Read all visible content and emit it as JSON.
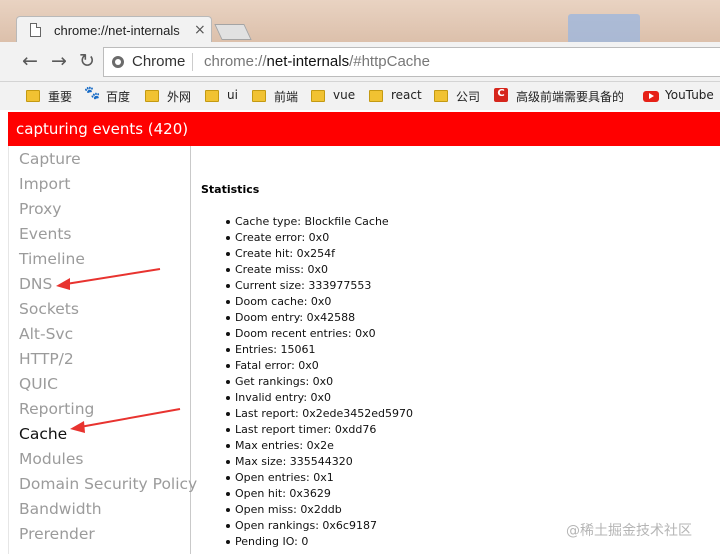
{
  "browser": {
    "tab_title": "chrome://net-internals",
    "tab_close_icon": "×",
    "nav": {
      "back_icon": "←",
      "forward_icon": "→",
      "reload_icon": "↻"
    },
    "omnibox": {
      "chip": "Chrome",
      "url_scheme": "chrome://",
      "url_host": "net-internals",
      "url_path": "/#httpCache"
    }
  },
  "bookmarks": [
    {
      "label": "重要",
      "icon": "folder-icon"
    },
    {
      "label": "百度",
      "icon": "baidu-paw-icon"
    },
    {
      "label": "外网",
      "icon": "folder-icon"
    },
    {
      "label": "ui",
      "icon": "folder-icon"
    },
    {
      "label": "前端",
      "icon": "folder-icon"
    },
    {
      "label": "vue",
      "icon": "folder-icon"
    },
    {
      "label": "react",
      "icon": "folder-icon"
    },
    {
      "label": "公司",
      "icon": "folder-icon"
    },
    {
      "label": "高级前端需要具备的",
      "icon": "csdn-icon",
      "icon_text": "C"
    },
    {
      "label": "YouTube",
      "icon": "youtube-icon"
    }
  ],
  "status": {
    "text": "capturing events (420)",
    "color": "#ff0000"
  },
  "sidebar": {
    "items": [
      "Capture",
      "Import",
      "Proxy",
      "Events",
      "Timeline",
      "DNS",
      "Sockets",
      "Alt-Svc",
      "HTTP/2",
      "QUIC",
      "Reporting",
      "Cache",
      "Modules",
      "Domain Security Policy",
      "Bandwidth",
      "Prerender"
    ],
    "active": "Cache"
  },
  "content": {
    "section_title": "Statistics",
    "stats": [
      "Cache type: Blockfile Cache",
      "Create error: 0x0",
      "Create hit: 0x254f",
      "Create miss: 0x0",
      "Current size: 333977553",
      "Doom cache: 0x0",
      "Doom entry: 0x42588",
      "Doom recent entries: 0x0",
      "Entries: 15061",
      "Fatal error: 0x0",
      "Get rankings: 0x0",
      "Invalid entry: 0x0",
      "Last report: 0x2ede3452ed5970",
      "Last report timer: 0xdd76",
      "Max entries: 0x2e",
      "Max size: 335544320",
      "Open entries: 0x1",
      "Open hit: 0x3629",
      "Open miss: 0x2ddb",
      "Open rankings: 0x6c9187",
      "Pending IO: 0"
    ]
  },
  "annotations": {
    "arrow_color": "#e8332f",
    "arrow_targets": [
      "DNS",
      "Cache"
    ]
  },
  "watermark": "@稀土掘金技术社区"
}
